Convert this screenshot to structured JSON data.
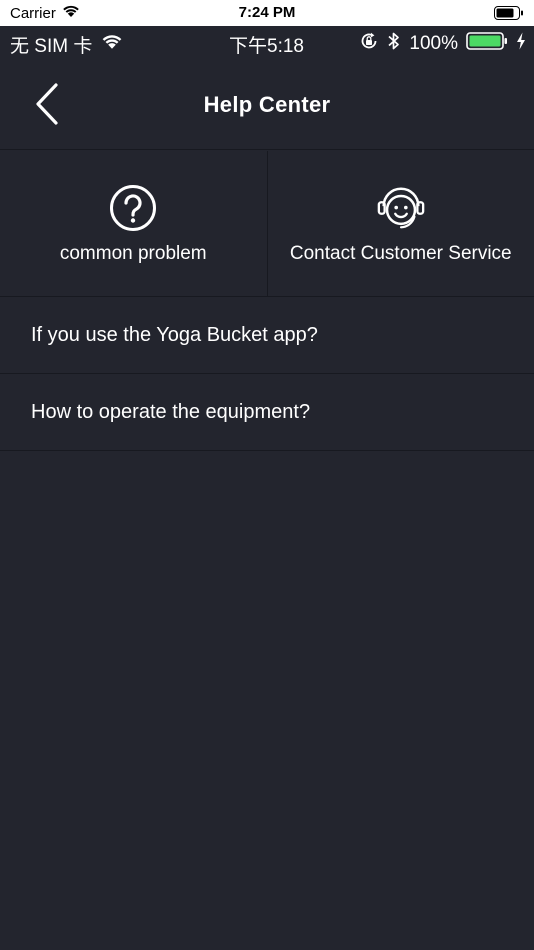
{
  "sim_status": {
    "carrier": "Carrier",
    "time": "7:24 PM"
  },
  "app_status": {
    "sim": "无 SIM 卡",
    "time": "下午5:18",
    "battery": "100%"
  },
  "nav": {
    "title": "Help Center"
  },
  "options": [
    {
      "label": "common problem",
      "icon": "question-circle-icon"
    },
    {
      "label": "Contact Customer Service",
      "icon": "headset-icon"
    }
  ],
  "faq": [
    {
      "text": "If you use the Yoga Bucket app?"
    },
    {
      "text": "How to operate the equipment?"
    }
  ],
  "colors": {
    "background": "#23252e",
    "divider": "#171920",
    "text": "#ffffff",
    "battery": "#4cd964"
  }
}
